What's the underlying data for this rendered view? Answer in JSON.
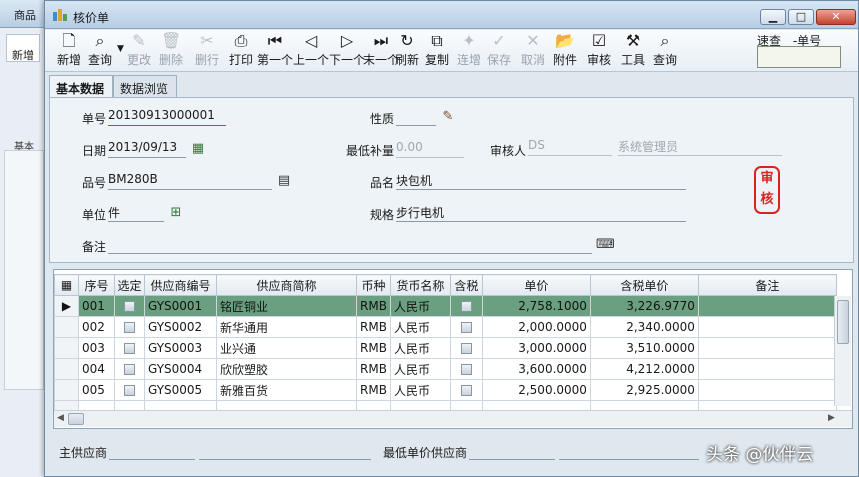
{
  "background_window": {
    "title": "商品",
    "button": "新增",
    "label": "基本"
  },
  "window": {
    "title": "核价单",
    "minimize": "▁",
    "maximize": "□",
    "close": "✕"
  },
  "toolbar": [
    {
      "label": "新增",
      "icon": "new-doc-icon",
      "enabled": true
    },
    {
      "label": "查询",
      "icon": "search-icon",
      "enabled": true
    },
    {
      "label": "更改",
      "icon": "pencil-icon",
      "enabled": false
    },
    {
      "label": "删除",
      "icon": "trash-icon",
      "enabled": false
    },
    {
      "label": "删行",
      "icon": "delete-row-icon",
      "enabled": false
    },
    {
      "label": "打印",
      "icon": "printer-icon",
      "enabled": true
    },
    {
      "label": "第一个",
      "icon": "first-icon",
      "enabled": true
    },
    {
      "label": "上一个",
      "icon": "prev-icon",
      "enabled": true
    },
    {
      "label": "下一个",
      "icon": "next-icon",
      "enabled": true
    },
    {
      "label": "末一个",
      "icon": "last-icon",
      "enabled": true
    },
    {
      "label": "刷新",
      "icon": "refresh-icon",
      "enabled": true
    },
    {
      "label": "复制",
      "icon": "copy-icon",
      "enabled": true
    },
    {
      "label": "连增",
      "icon": "continuous-add-icon",
      "enabled": false
    },
    {
      "label": "保存",
      "icon": "check-icon",
      "enabled": false
    },
    {
      "label": "取消",
      "icon": "cancel-icon",
      "enabled": false
    },
    {
      "label": "附件",
      "icon": "folder-icon",
      "enabled": true
    },
    {
      "label": "审核",
      "icon": "approve-icon",
      "enabled": true
    },
    {
      "label": "工具",
      "icon": "tools-icon",
      "enabled": true
    },
    {
      "label": "查询",
      "icon": "magnifier-icon",
      "enabled": true
    }
  ],
  "quick_search": {
    "label": "速查",
    "field": "-单号",
    "value": ""
  },
  "tabs": [
    "基本数据",
    "数据浏览"
  ],
  "form": {
    "order_no_label": "单号",
    "order_no": "20130913000001",
    "nature_label": "性质",
    "nature": "",
    "date_label": "日期",
    "date": "2013/09/13",
    "min_qty_label": "最低补量",
    "min_qty": "0.00",
    "reviewer_label": "审核人",
    "reviewer_code": "DS",
    "reviewer_name": "系统管理员",
    "item_no_label": "品号",
    "item_no": "BM280B",
    "item_name_label": "品名",
    "item_name": "块包机",
    "unit_label": "单位",
    "unit": "件",
    "spec_label": "规格",
    "spec": "步行电机",
    "remark_label": "备注",
    "remark": "",
    "stamp": "审核"
  },
  "grid": {
    "headers": [
      "序号",
      "选定",
      "供应商编号",
      "供应商简称",
      "币种",
      "货币名称",
      "含税",
      "单价",
      "含税单价",
      "备注"
    ],
    "rows": [
      {
        "seq": "001",
        "code": "GYS0001",
        "name": "铭匠铜业",
        "cur": "RMB",
        "cur_name": "人民币",
        "price": "2,758.1000",
        "tax_price": "3,226.9770",
        "remark": "",
        "selected_row": true
      },
      {
        "seq": "002",
        "code": "GYS0002",
        "name": "新华通用",
        "cur": "RMB",
        "cur_name": "人民币",
        "price": "2,000.0000",
        "tax_price": "2,340.0000",
        "remark": "",
        "selected_row": false
      },
      {
        "seq": "003",
        "code": "GYS0003",
        "name": "业兴通",
        "cur": "RMB",
        "cur_name": "人民币",
        "price": "3,000.0000",
        "tax_price": "3,510.0000",
        "remark": "",
        "selected_row": false
      },
      {
        "seq": "004",
        "code": "GYS0004",
        "name": "欣欣塑胶",
        "cur": "RMB",
        "cur_name": "人民币",
        "price": "3,600.0000",
        "tax_price": "4,212.0000",
        "remark": "",
        "selected_row": false
      },
      {
        "seq": "005",
        "code": "GYS0005",
        "name": "新雅百货",
        "cur": "RMB",
        "cur_name": "人民币",
        "price": "2,500.0000",
        "tax_price": "2,925.0000",
        "remark": "",
        "selected_row": false
      }
    ]
  },
  "footer": {
    "main_supplier_label": "主供应商",
    "main_supplier": "",
    "lowest_supplier_label": "最低单价供应商",
    "lowest_supplier": ""
  },
  "watermark": "头条 @伙伴云"
}
